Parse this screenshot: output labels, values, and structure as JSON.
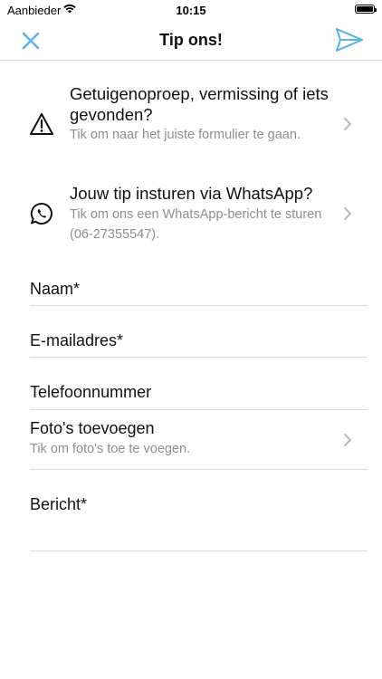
{
  "status_bar": {
    "carrier": "Aanbieder",
    "time": "10:15",
    "battery_level": 1.0
  },
  "navbar": {
    "title": "Tip ons!",
    "close_icon": "close-icon",
    "send_icon": "paper-plane-icon",
    "accent_color": "#5ab4e5"
  },
  "links": [
    {
      "icon": "warning-triangle-icon",
      "title": "Getuigenoproep, vermissing of iets gevonden?",
      "subtitle": "Tik om naar het juiste formulier te gaan."
    },
    {
      "icon": "whatsapp-icon",
      "title": "Jouw tip insturen via WhatsApp?",
      "subtitle": "Tik om ons een WhatsApp-bericht te sturen (06-27355547)."
    }
  ],
  "form": {
    "name_label": "Naam*",
    "email_label": "E-mailadres*",
    "phone_label": "Telefoonnummer",
    "photos_title": "Foto's toevoegen",
    "photos_subtitle": "Tik om foto's toe te voegen.",
    "message_label": "Bericht*"
  }
}
